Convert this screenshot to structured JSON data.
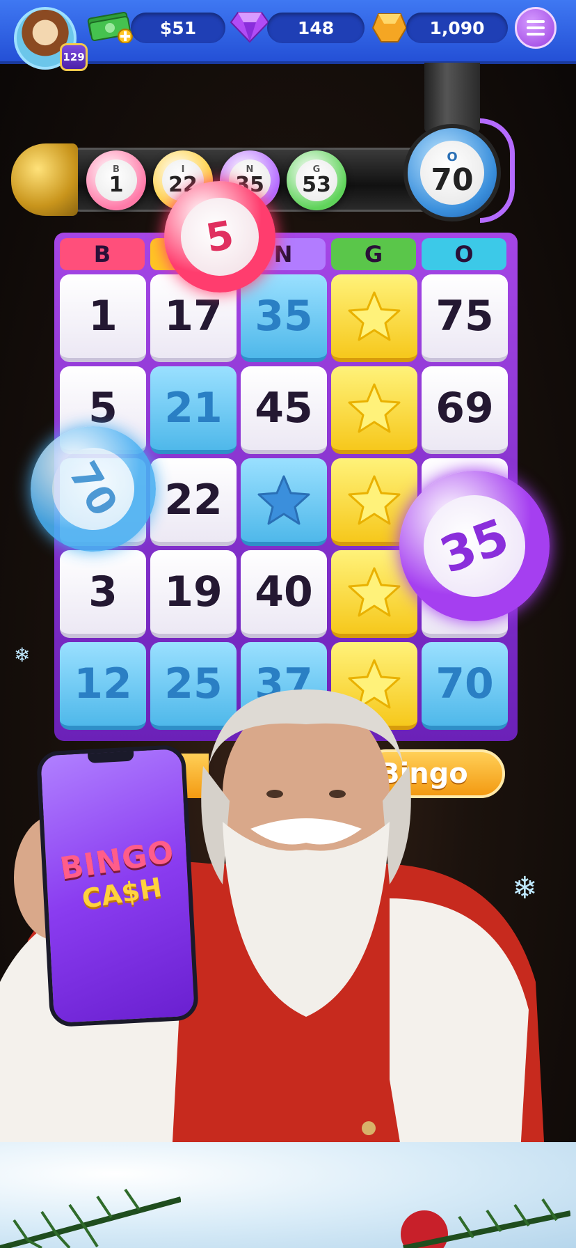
{
  "topbar": {
    "level": "129",
    "cash": "$51",
    "gems": "148",
    "coins": "1,090"
  },
  "tube": {
    "balls": [
      {
        "letter": "B",
        "number": "1",
        "color": "#ff7aa8"
      },
      {
        "letter": "I",
        "number": "22",
        "color": "#ffcf3a"
      },
      {
        "letter": "N",
        "number": "35",
        "color": "#b46bff"
      },
      {
        "letter": "G",
        "number": "53",
        "color": "#5fd35a"
      }
    ],
    "current": {
      "letter": "O",
      "number": "70"
    }
  },
  "card": {
    "headers": [
      {
        "letter": "B",
        "color": "#ff4f7b"
      },
      {
        "letter": "I",
        "color": "#ffc623"
      },
      {
        "letter": "N",
        "color": "#b27cff"
      },
      {
        "letter": "G",
        "color": "#5ac64a"
      },
      {
        "letter": "O",
        "color": "#3cc9e8"
      }
    ],
    "rows": [
      [
        {
          "v": "1",
          "s": "plain"
        },
        {
          "v": "17",
          "s": "plain"
        },
        {
          "v": "35",
          "s": "marked"
        },
        {
          "v": "",
          "s": "star"
        },
        {
          "v": "75",
          "s": "plain"
        }
      ],
      [
        {
          "v": "5",
          "s": "plain"
        },
        {
          "v": "21",
          "s": "marked"
        },
        {
          "v": "45",
          "s": "plain"
        },
        {
          "v": "",
          "s": "star"
        },
        {
          "v": "69",
          "s": "plain"
        }
      ],
      [
        {
          "v": "",
          "s": "plain"
        },
        {
          "v": "22",
          "s": "plain"
        },
        {
          "v": "",
          "s": "bluestar"
        },
        {
          "v": "",
          "s": "star"
        },
        {
          "v": "",
          "s": "plain"
        }
      ],
      [
        {
          "v": "3",
          "s": "plain"
        },
        {
          "v": "19",
          "s": "plain"
        },
        {
          "v": "40",
          "s": "plain"
        },
        {
          "v": "",
          "s": "star"
        },
        {
          "v": "",
          "s": "plain"
        }
      ],
      [
        {
          "v": "12",
          "s": "marked"
        },
        {
          "v": "25",
          "s": "marked"
        },
        {
          "v": "37",
          "s": "marked"
        },
        {
          "v": "",
          "s": "star"
        },
        {
          "v": "70",
          "s": "marked"
        }
      ]
    ]
  },
  "flying_balls": [
    {
      "number": "5",
      "color": "#ff3d6e"
    },
    {
      "number": "70",
      "color": "#4ab0f2"
    },
    {
      "number": "35",
      "color": "#a53ff0"
    }
  ],
  "bingo_button": {
    "label": "Bingo"
  },
  "phone_logo": {
    "line1": "BINGO",
    "line2": "CA$H"
  }
}
